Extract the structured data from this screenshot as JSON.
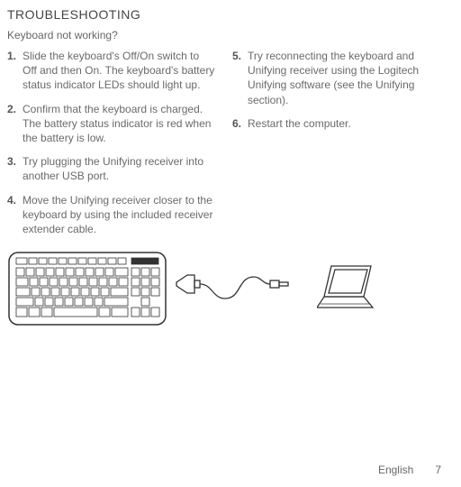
{
  "title": "TROUBLESHOOTING",
  "subtitle": "Keyboard not working?",
  "steps_left": [
    {
      "n": "1.",
      "t": "Slide the keyboard's Off/On switch to Off and then On. The keyboard's battery status indicator LEDs should light up."
    },
    {
      "n": "2.",
      "t": "Confirm that the keyboard is charged. The battery status indicator is red when the battery is low."
    },
    {
      "n": "3.",
      "t": "Try plugging the Unifying receiver into another USB port."
    },
    {
      "n": "4.",
      "t": "Move the Unifying receiver closer to the keyboard by using the included receiver extender cable."
    }
  ],
  "steps_right": [
    {
      "n": "5.",
      "t": "Try reconnecting the keyboard and Unifying receiver using the Logitech Unifying software (see the Unifying section)."
    },
    {
      "n": "6.",
      "t": "Restart the computer."
    }
  ],
  "footer_lang": "English",
  "footer_page": "7"
}
